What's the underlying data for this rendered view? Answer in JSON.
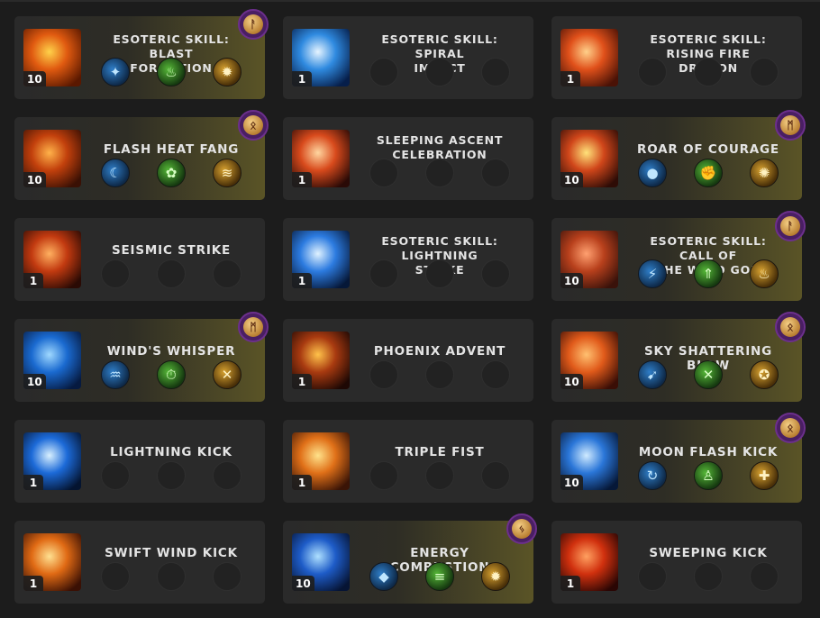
{
  "skills": [
    {
      "name": "ESOTERIC SKILL: BLAST\nFORMATION",
      "level": "10",
      "active": true,
      "rune": "ᚨ",
      "tripods": [
        {
          "icon": "tiger-icon",
          "glyph": "✦",
          "color": "blue"
        },
        {
          "icon": "flame-icon",
          "glyph": "♨",
          "color": "green"
        },
        {
          "icon": "burst-icon",
          "glyph": "✹",
          "color": "gold"
        }
      ],
      "art": [
        "#ffd24a",
        "#e05a10",
        "#5a1800"
      ]
    },
    {
      "name": "ESOTERIC SKILL: SPIRAL\nIMPACT",
      "level": "1",
      "active": false,
      "art": [
        "#e6f4ff",
        "#2f8ae0",
        "#061e4a"
      ]
    },
    {
      "name": "ESOTERIC SKILL: RISING FIRE\nDRAGON",
      "level": "1",
      "active": false,
      "art": [
        "#ffd08a",
        "#e0501a",
        "#4a1206"
      ]
    },
    {
      "name": "FLASH HEAT FANG",
      "level": "10",
      "active": true,
      "rune": "ᛟ",
      "tripods": [
        {
          "icon": "crescent-moon-icon",
          "glyph": "☾",
          "color": "blue"
        },
        {
          "icon": "beast-icon",
          "glyph": "✿",
          "color": "green"
        },
        {
          "icon": "fire-slash-icon",
          "glyph": "≋",
          "color": "gold"
        }
      ],
      "art": [
        "#ffb24a",
        "#c2400c",
        "#3a1004"
      ]
    },
    {
      "name": "SLEEPING ASCENT\nCELEBRATION",
      "level": "1",
      "active": false,
      "art": [
        "#ffd6a0",
        "#d84a1c",
        "#2a0a06"
      ]
    },
    {
      "name": "ROAR OF COURAGE",
      "level": "10",
      "active": true,
      "rune": "ᛗ",
      "tripods": [
        {
          "icon": "orb-up-icon",
          "glyph": "●",
          "color": "blue"
        },
        {
          "icon": "claw-icon",
          "glyph": "✊",
          "color": "green"
        },
        {
          "icon": "shock-icon",
          "glyph": "✺",
          "color": "gold"
        }
      ],
      "art": [
        "#ffe27a",
        "#d0461a",
        "#2e0c06"
      ]
    },
    {
      "name": "SEISMIC STRIKE",
      "level": "1",
      "active": false,
      "art": [
        "#ffb060",
        "#c23a10",
        "#2a0a04"
      ]
    },
    {
      "name": "ESOTERIC SKILL: LIGHTNING\nSTRIKE",
      "level": "1",
      "active": false,
      "art": [
        "#e0f2ff",
        "#2c7be0",
        "#061838"
      ]
    },
    {
      "name": "ESOTERIC SKILL: CALL OF\nTHE WIND GOD",
      "level": "10",
      "active": true,
      "rune": "ᚨ",
      "tripods": [
        {
          "icon": "wind-slash-icon",
          "glyph": "⚡",
          "color": "blue"
        },
        {
          "icon": "arrow-up-icon",
          "glyph": "⇑",
          "color": "green"
        },
        {
          "icon": "fire-wave-icon",
          "glyph": "♨",
          "color": "gold"
        }
      ],
      "art": [
        "#ffa070",
        "#b8401c",
        "#3a120a"
      ]
    },
    {
      "name": "WIND'S WHISPER",
      "level": "10",
      "active": true,
      "rune": "ᛗ",
      "tripods": [
        {
          "icon": "jaw-icon",
          "glyph": "♒",
          "color": "blue"
        },
        {
          "icon": "speed-up-icon",
          "glyph": "⏱",
          "color": "green"
        },
        {
          "icon": "cross-swords-icon",
          "glyph": "✕",
          "color": "gold"
        }
      ],
      "art": [
        "#9fd8ff",
        "#1a6ad0",
        "#061a40"
      ]
    },
    {
      "name": "PHOENIX ADVENT",
      "level": "1",
      "active": false,
      "art": [
        "#ffc24a",
        "#a83a10",
        "#1e0804"
      ]
    },
    {
      "name": "SKY SHATTERING BLOW",
      "level": "10",
      "active": true,
      "rune": "ᛟ",
      "tripods": [
        {
          "icon": "dash-icon",
          "glyph": "➹",
          "color": "blue"
        },
        {
          "icon": "cross-blades-icon",
          "glyph": "✕",
          "color": "green"
        },
        {
          "icon": "bomb-up-icon",
          "glyph": "✪",
          "color": "gold"
        }
      ],
      "art": [
        "#ffc070",
        "#e05a1a",
        "#3a0e06"
      ]
    },
    {
      "name": "LIGHTNING KICK",
      "level": "1",
      "active": false,
      "art": [
        "#d8f0ff",
        "#1c6ad8",
        "#041430"
      ]
    },
    {
      "name": "TRIPLE FIST",
      "level": "1",
      "active": false,
      "art": [
        "#ffe28a",
        "#e07018",
        "#3a1406"
      ]
    },
    {
      "name": "MOON FLASH KICK",
      "level": "10",
      "active": true,
      "rune": "ᛟ",
      "tripods": [
        {
          "icon": "swoop-icon",
          "glyph": "↻",
          "color": "blue"
        },
        {
          "icon": "person-icon",
          "glyph": "♙",
          "color": "green"
        },
        {
          "icon": "ground-burst-icon",
          "glyph": "✚",
          "color": "gold"
        }
      ],
      "art": [
        "#cfeaff",
        "#2a76d8",
        "#061838"
      ]
    },
    {
      "name": "SWIFT WIND KICK",
      "level": "1",
      "active": false,
      "art": [
        "#ffe090",
        "#e06a14",
        "#3a1004"
      ]
    },
    {
      "name": "ENERGY COMBUSTION",
      "level": "10",
      "active": true,
      "rune": "ᛃ",
      "tripods": [
        {
          "icon": "crystal-icon",
          "glyph": "◆",
          "color": "blue"
        },
        {
          "icon": "blade-wave-icon",
          "glyph": "≡",
          "color": "green"
        },
        {
          "icon": "sun-burst-icon",
          "glyph": "✹",
          "color": "gold"
        }
      ],
      "art": [
        "#aee0ff",
        "#1e5cc8",
        "#061434"
      ]
    },
    {
      "name": "SWEEPING KICK",
      "level": "1",
      "active": false,
      "art": [
        "#ffa060",
        "#d0300e",
        "#2a0604"
      ]
    }
  ]
}
